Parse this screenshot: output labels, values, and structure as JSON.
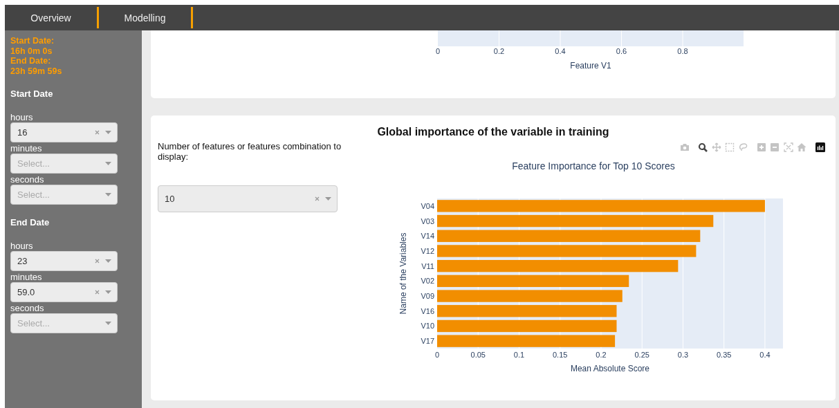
{
  "nav": {
    "tabs": [
      {
        "label": "Overview"
      },
      {
        "label": "Modelling"
      }
    ]
  },
  "sidebar": {
    "summary": [
      "Start Date:",
      "16h 0m 0s",
      "End Date:",
      "23h 59m 59s"
    ],
    "groups": [
      {
        "title": "Start Date",
        "fields": [
          {
            "label": "hours",
            "value": "16"
          },
          {
            "label": "minutes",
            "placeholder": "Select..."
          },
          {
            "label": "seconds",
            "placeholder": "Select..."
          }
        ]
      },
      {
        "title": "End Date",
        "fields": [
          {
            "label": "hours",
            "value": "23"
          },
          {
            "label": "minutes",
            "value": "59.0"
          },
          {
            "label": "seconds",
            "placeholder": "Select..."
          }
        ]
      }
    ]
  },
  "feature_chart": {
    "tick_labels": [
      "0",
      "0.2",
      "0.4",
      "0.6",
      "0.8"
    ],
    "axis_title": "Feature V1"
  },
  "importance_panel": {
    "title": "Global importance of the variable in training",
    "features_label": "Number of features or features combination to display:",
    "features_select": {
      "value": "10"
    },
    "modebar": [
      {
        "kind": "camera",
        "selected": false
      },
      {
        "kind": "zoom",
        "selected": true
      },
      {
        "kind": "pan",
        "selected": false
      },
      {
        "kind": "box",
        "selected": false
      },
      {
        "kind": "lasso",
        "selected": false
      },
      {
        "kind": "zoomin",
        "selected": false
      },
      {
        "kind": "zoomout",
        "selected": false
      },
      {
        "kind": "autoscale",
        "selected": false
      },
      {
        "kind": "home",
        "selected": false
      },
      {
        "kind": "logo"
      }
    ],
    "chart_data": {
      "type": "bar",
      "orientation": "h",
      "title": "Feature Importance for Top 10 Scores",
      "xlabel": "Mean Absolute Score",
      "ylabel": "Name of the Variables",
      "categories": [
        "V04",
        "V03",
        "V14",
        "V12",
        "V11",
        "V02",
        "V09",
        "V16",
        "V10",
        "V17"
      ],
      "values": [
        0.4,
        0.337,
        0.321,
        0.316,
        0.294,
        0.234,
        0.226,
        0.219,
        0.219,
        0.217
      ],
      "xticks": [
        0,
        0.05,
        0.1,
        0.15,
        0.2,
        0.25,
        0.3,
        0.35,
        0.4
      ],
      "xlim": [
        0,
        0.422
      ],
      "grid": true
    }
  }
}
